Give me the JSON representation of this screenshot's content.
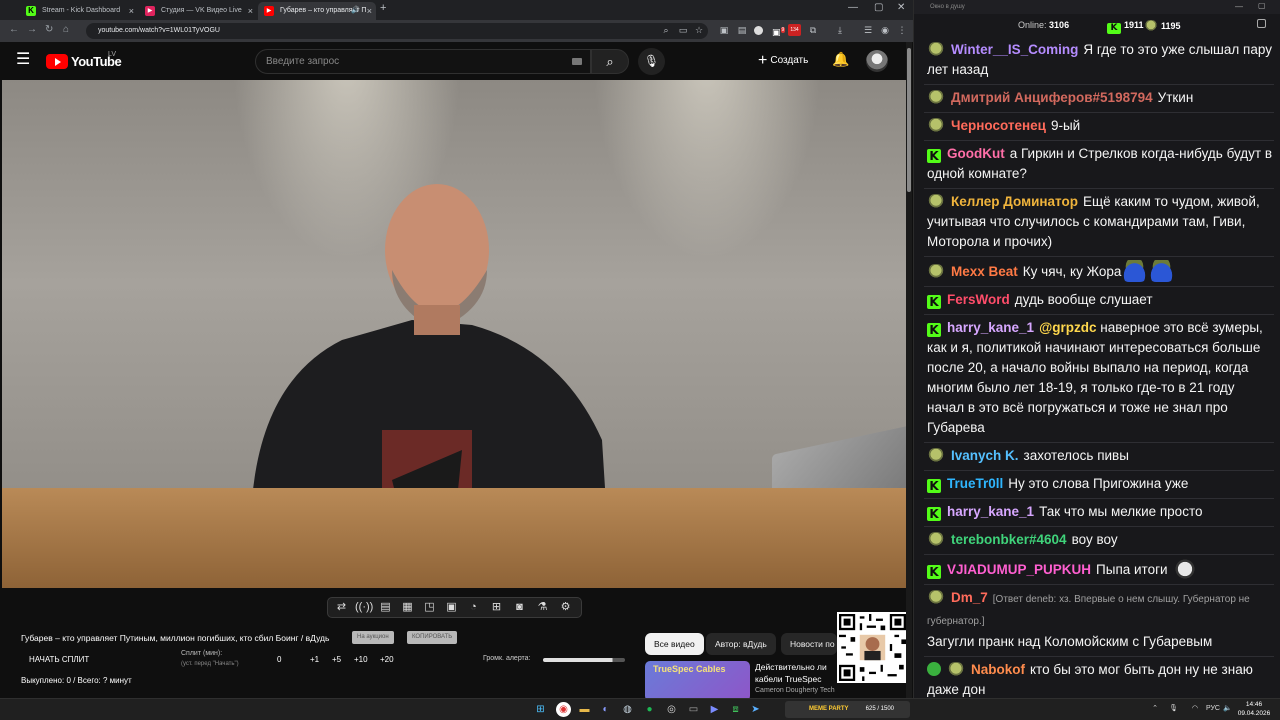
{
  "browser": {
    "tabs": [
      {
        "label": "Stream - Kick Dashboard",
        "favicon_color": "#53fc18",
        "favicon": "K"
      },
      {
        "label": "Студия — VK Видео Live",
        "favicon_color": "#e0245e",
        "favicon": "▶"
      },
      {
        "label": "Губарев – кто управляет П",
        "favicon_color": "#ff0000",
        "favicon": "▶",
        "active": true
      }
    ],
    "new_tab": "+",
    "url": "youtube.com/watch?v=1WL01TyVOGU",
    "window_controls": [
      "—",
      "▢",
      "✕"
    ],
    "extension_badges": [
      "9",
      "134"
    ]
  },
  "youtube": {
    "logo_text": "YouTube",
    "region": "LV",
    "search_placeholder": "Введите запрос",
    "create_label": "Создать",
    "video_title": "Губарев – кто управляет Путиным, миллион погибших, кто сбил Боинг / вДудь",
    "mini_buttons": [
      "На аукцион",
      "КОПИРОВАТЬ"
    ],
    "filters": [
      "Все видео",
      "Автор: вДудь",
      "Новости по"
    ],
    "recommendation": {
      "thumb_text": "TrueSpec Cables",
      "title": "Действительно ли кабели TrueSpec хороши?",
      "channel": "Cameron Dougherty Tech"
    }
  },
  "split_panel": {
    "start_label": "НАЧАТЬ СПЛИТ",
    "split_label": "Сплит (мин):",
    "split_hint": "(уст. перед \"Начать\")",
    "values": [
      "0",
      "+1",
      "+5",
      "+10",
      "+20"
    ],
    "alert_volume_label": "Громк. алерта:",
    "alert_volume": 0.85,
    "bought": "Выкуплено: 0 / Всего: ? минут"
  },
  "video_toolbar_icons": [
    "repeat-icon",
    "broadcast-icon",
    "playlist-icon",
    "film-icon",
    "pip-icon",
    "subtitles-icon",
    "speed-icon",
    "add-icon",
    "camera-icon",
    "lab-icon",
    "settings-icon"
  ],
  "chat": {
    "window_title": "Окно в душу",
    "online_label": "Online:",
    "online_count": "3106",
    "kick_count": "1911",
    "vk_count": "1195",
    "messages": [
      {
        "platform": "vk",
        "user": "Winter__IS_Coming",
        "color": "#b58cff",
        "text": "Я где то это уже слышал пару лет назад"
      },
      {
        "platform": "vk",
        "user": "Дмитрий Анциферов#5198794",
        "color": "#d2695e",
        "text": "Уткин"
      },
      {
        "platform": "vk",
        "user": "Черносотенец",
        "color": "#ff6b5b",
        "text": "9-ый"
      },
      {
        "platform": "kick",
        "user": "GoodKut",
        "color": "#ff6fa8",
        "text": "а Гиркин и Стрелков когда-нибудь будут в одной комнате?"
      },
      {
        "platform": "vk",
        "user": "Келлер Доминатор",
        "color": "#f0b43c",
        "text": "Ещё каким то чудом, живой, учитывая что случилось с командирами там, Гиви, Моторола и прочих)"
      },
      {
        "platform": "vk",
        "user": "Mexx Beat",
        "color": "#ff7a45",
        "text": "Ку чяч, ку Жора",
        "emotes": 2
      },
      {
        "platform": "kick",
        "user": "FersWord",
        "color": "#ff4d6a",
        "text": "дудь вообще слушает"
      },
      {
        "platform": "kick",
        "user": "harry_kane_1",
        "color": "#d7a7ff",
        "mention": "@grpzdc",
        "text": "наверное это всё зумеры, как и я, политикой начинают интересоваться больше после 20, а начало войны выпало на период, когда многим было лет 18-19, я только где-то в 21 году начал в это всё погружаться и тоже не знал про Губарева"
      },
      {
        "platform": "vk",
        "user": "Ivanych K.",
        "color": "#55c0ff",
        "text": "захотелось пивы"
      },
      {
        "platform": "kick",
        "user": "TrueTr0ll",
        "color": "#2fb6ff",
        "text": "Ну это слова Пригожина уже"
      },
      {
        "platform": "kick",
        "user": "harry_kane_1",
        "color": "#d7a7ff",
        "text": "Так что мы мелкие просто"
      },
      {
        "platform": "vk",
        "user": "terebonbker#4604",
        "color": "#3fd37a",
        "text": "воу воу"
      },
      {
        "platform": "kick",
        "user": "VJIADUMUP_PUPKUH",
        "color": "#ff5fd0",
        "text": "Пыпа итоги",
        "emotes_cat": 1
      },
      {
        "platform": "vk",
        "user": "Dm_7",
        "color": "#ff6b5b",
        "reply": "[Ответ deneb: хз. Впервые о нем слышу. Губернатор не губернатор.]",
        "text": "Загугли пранк над Коломойским с Губаревым"
      },
      {
        "platform": "modvk",
        "user": "Nabokof",
        "color": "#ff8c4d",
        "text": "кто бы это мог быть дон ну не знаю даже дон"
      }
    ]
  },
  "taskbar": {
    "widget_party": "MEME PARTY",
    "widget_count": "625 / 1500",
    "tray_lang": "РУС",
    "time": "14:46",
    "date": "09.04.2026"
  },
  "colors": {
    "youtube_red": "#ff0000",
    "kick_green": "#53fc18",
    "chat_bg": "#18181b"
  }
}
